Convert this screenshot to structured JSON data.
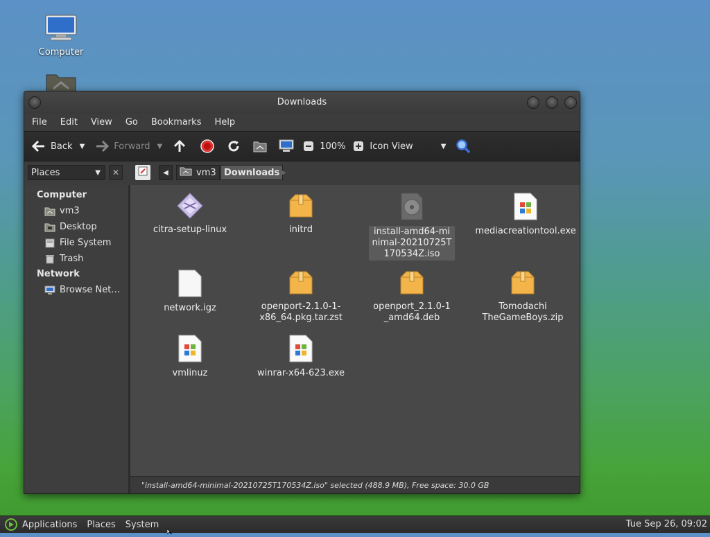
{
  "desktop": {
    "computer_label": "Computer"
  },
  "window": {
    "title": "Downloads",
    "menu": [
      "File",
      "Edit",
      "View",
      "Go",
      "Bookmarks",
      "Help"
    ],
    "toolbar": {
      "back": "Back",
      "forward": "Forward",
      "zoom": "100%",
      "view_mode": "Icon View"
    },
    "sidebar": {
      "combo_label": "Places",
      "computer_heading": "Computer",
      "computer_items": [
        {
          "label": "vm3",
          "icon": "home-folder-icon"
        },
        {
          "label": "Desktop",
          "icon": "desktop-folder-icon"
        },
        {
          "label": "File System",
          "icon": "drive-icon"
        },
        {
          "label": "Trash",
          "icon": "trash-icon"
        }
      ],
      "network_heading": "Network",
      "network_items": [
        {
          "label": "Browse Net…",
          "icon": "network-icon"
        }
      ]
    },
    "path": [
      "vm3",
      "Downloads"
    ],
    "files": [
      {
        "name": "citra-setup-linux",
        "icon": "executable-icon"
      },
      {
        "name": "initrd",
        "icon": "archive-icon"
      },
      {
        "name": "install-amd64-minimal-20210725T170534Z.iso",
        "icon": "disc-image-icon",
        "selected": true
      },
      {
        "name": "mediacreationtool.exe",
        "icon": "windows-exe-icon"
      },
      {
        "name": "network.igz",
        "icon": "blank-file-icon"
      },
      {
        "name": "openport-2.1.0-1-x86_64.pkg.tar.zst",
        "icon": "archive-icon"
      },
      {
        "name": "openport_2.1.0-1_amd64.deb",
        "icon": "archive-icon"
      },
      {
        "name": "Tomodachi TheGameBoys.zip",
        "icon": "archive-icon"
      },
      {
        "name": "vmlinuz",
        "icon": "windows-exe-icon"
      },
      {
        "name": "winrar-x64-623.exe",
        "icon": "windows-exe-icon"
      }
    ],
    "status": "\"install-amd64-minimal-20210725T170534Z.iso\" selected (488.9 MB), Free space: 30.0 GB"
  },
  "taskbar": {
    "menus": [
      "Applications",
      "Places",
      "System"
    ],
    "clock": "Tue Sep 26, 09:02"
  }
}
